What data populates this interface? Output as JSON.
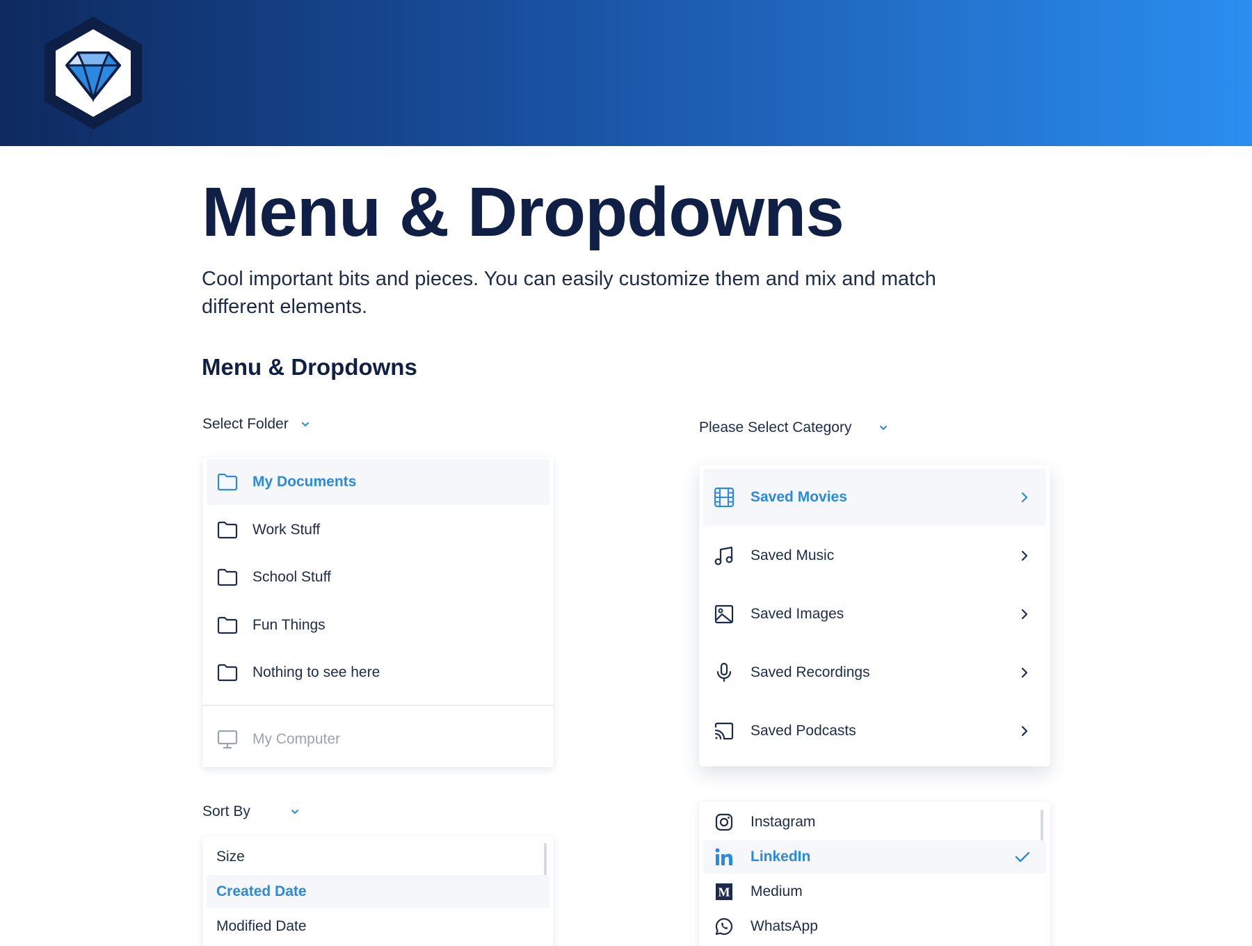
{
  "header": {
    "logo_icon": "diamond-logo-icon",
    "gradient_start": "#0e2a5f",
    "gradient_end": "#2a8ef0"
  },
  "page": {
    "title": "Menu & Dropdowns",
    "subtitle": "Cool important bits and pieces. You can easily customize them and mix and match different elements.",
    "section_title": "Menu & Dropdowns"
  },
  "colors": {
    "accent": "#2b8ae0",
    "text": "#1c2b4d",
    "muted": "#9aa3b2",
    "heading": "#0f1f45"
  },
  "folder_dropdown": {
    "label": "Select Folder",
    "items": [
      {
        "label": "My Documents",
        "icon": "folder-icon",
        "active": true
      },
      {
        "label": "Work Stuff",
        "icon": "folder-icon",
        "active": false
      },
      {
        "label": "School Stuff",
        "icon": "folder-icon",
        "active": false
      },
      {
        "label": "Fun Things",
        "icon": "folder-icon",
        "active": false
      },
      {
        "label": "Nothing to see here",
        "icon": "folder-icon",
        "active": false
      }
    ],
    "footer_item": {
      "label": "My Computer",
      "icon": "monitor-icon",
      "disabled": true
    }
  },
  "category_dropdown": {
    "label": "Please Select Category",
    "items": [
      {
        "label": "Saved Movies",
        "icon": "film-icon",
        "active": true
      },
      {
        "label": "Saved Music",
        "icon": "music-note-icon",
        "active": false
      },
      {
        "label": "Saved Images",
        "icon": "image-icon",
        "active": false
      },
      {
        "label": "Saved Recordings",
        "icon": "microphone-icon",
        "active": false
      },
      {
        "label": "Saved Podcasts",
        "icon": "cast-icon",
        "active": false
      }
    ]
  },
  "sort_dropdown": {
    "label": "Sort By",
    "items": [
      {
        "label": "Size",
        "active": false
      },
      {
        "label": "Created Date",
        "active": true
      },
      {
        "label": "Modified Date",
        "active": false
      }
    ]
  },
  "social_dropdown": {
    "items": [
      {
        "label": "Instagram",
        "icon": "instagram-icon",
        "active": false
      },
      {
        "label": "LinkedIn",
        "icon": "linkedin-icon",
        "active": true
      },
      {
        "label": "Medium",
        "icon": "medium-icon",
        "active": false
      },
      {
        "label": "WhatsApp",
        "icon": "whatsapp-icon",
        "active": false
      }
    ]
  }
}
